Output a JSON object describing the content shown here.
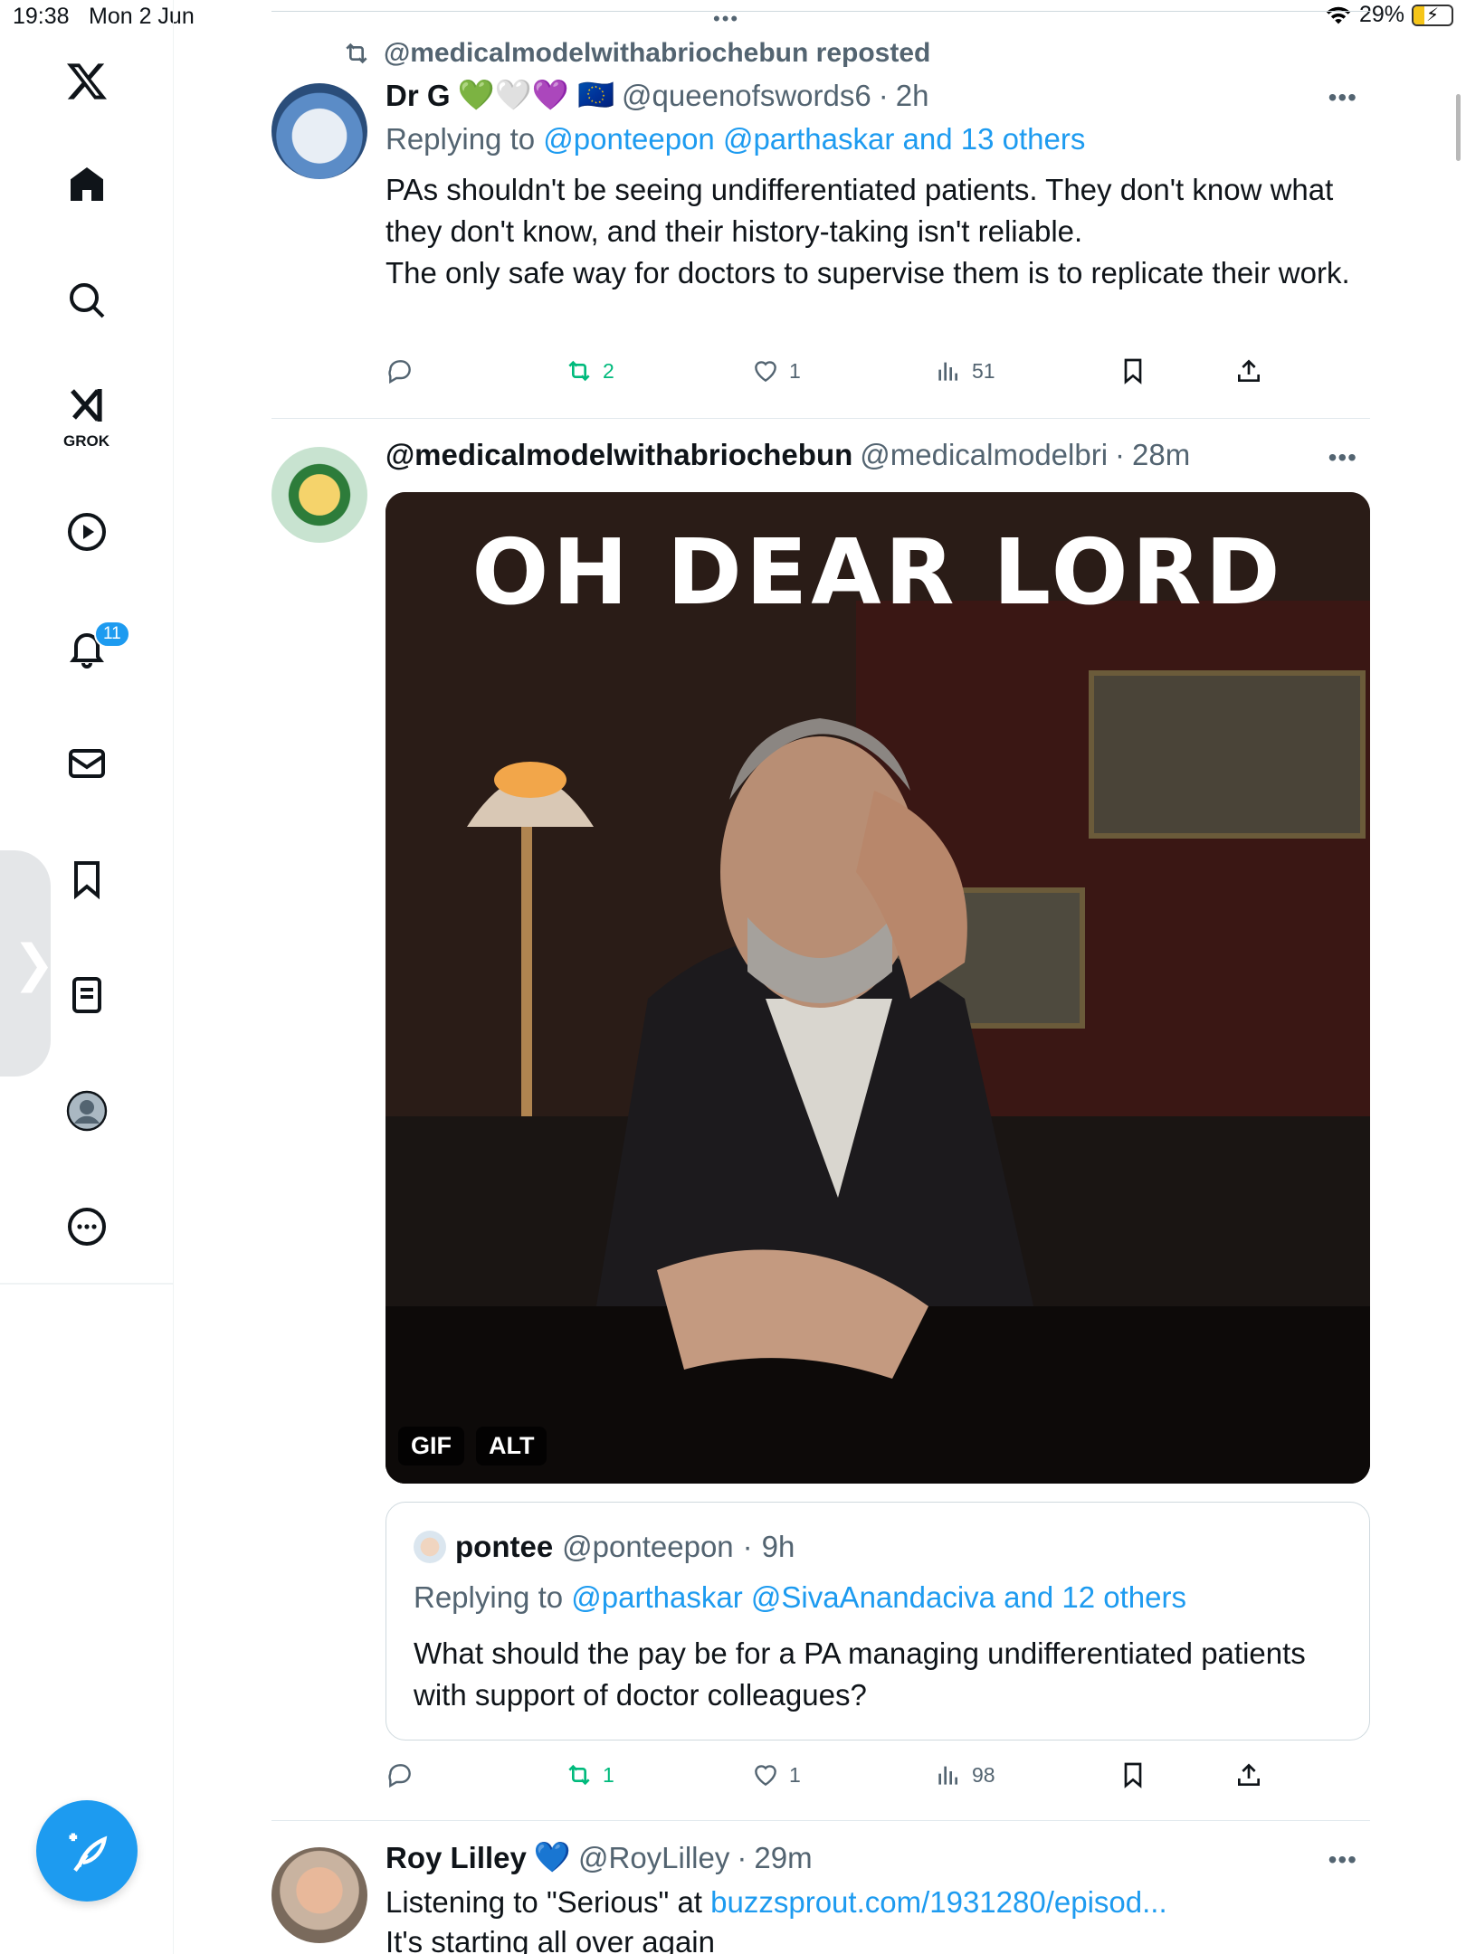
{
  "status_bar": {
    "time": "19:38",
    "date": "Mon 2 Jun",
    "battery": "29%"
  },
  "sidebar": {
    "grok_label": "GROK",
    "notifications_badge": "11",
    "items": [
      "x-logo",
      "home",
      "search",
      "grok",
      "videos",
      "notifications",
      "messages",
      "bookmarks",
      "lists",
      "profile",
      "more"
    ]
  },
  "tweets": [
    {
      "reposted_by": "@medicalmodelwithabriochebun reposted",
      "name": "Dr G",
      "emojis": "💚🤍💜 🇪🇺",
      "handle": "@queenofswords6",
      "time": "2h",
      "replying_prefix": "Replying to",
      "replying_to": "@ponteepon @parthaskar and 13 others",
      "text": "PAs shouldn't be seeing undifferentiated patients. They don't know what they don't know, and their history-taking isn't reliable.\nThe only safe way for doctors to supervise them is to replicate their work.",
      "stats": {
        "replies": "",
        "reposts": "2",
        "likes": "1",
        "views": "51"
      }
    },
    {
      "name": "@medicalmodelwithabriochebun",
      "handle": "@medicalmodelbri",
      "time": "28m",
      "gif_caption": "OH DEAR LORD",
      "gif_badge": "GIF",
      "alt_badge": "ALT",
      "quoted": {
        "name": "pontee",
        "handle": "@ponteepon",
        "time": "9h",
        "replying_prefix": "Replying to",
        "replying_to": "@parthaskar @SivaAnandaciva and 12 others",
        "text": "What should the pay be for a PA managing undifferentiated patients with support of doctor colleagues?"
      },
      "stats": {
        "replies": "",
        "reposts": "1",
        "likes": "1",
        "views": "98"
      }
    },
    {
      "name": "Roy Lilley",
      "emojis": "💙",
      "handle": "@RoyLilley",
      "time": "29m",
      "text_prefix": "Listening to \"Serious\" at ",
      "link": "buzzsprout.com/1931280/episod...",
      "text_line2": "It's starting all over again"
    }
  ],
  "colors": {
    "accent": "#1d9bf0",
    "repost_green": "#00ba7c",
    "muted": "#536471"
  }
}
